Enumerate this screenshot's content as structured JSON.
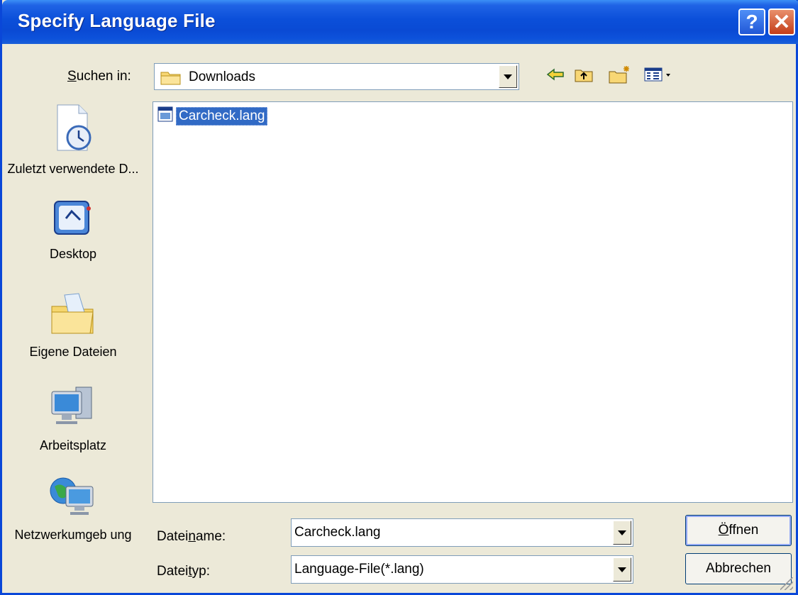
{
  "window": {
    "title": "Specify Language File"
  },
  "titlebar": {
    "help_label": "?",
    "close_label": "✕"
  },
  "toolbar": {
    "look_in_label_prefix": "",
    "look_in_label_key": "S",
    "look_in_label_rest": "uchen in:",
    "look_in_value": "Downloads",
    "icons": [
      "back-icon",
      "up-folder-icon",
      "new-folder-icon",
      "view-menu-icon"
    ]
  },
  "places": [
    {
      "label": "Zuletzt verwendete D...",
      "icon": "recent-documents-icon"
    },
    {
      "label": "Desktop",
      "icon": "desktop-icon"
    },
    {
      "label": "Eigene Dateien",
      "icon": "my-documents-icon"
    },
    {
      "label": "Arbeitsplatz",
      "icon": "my-computer-icon"
    },
    {
      "label": "Netzwerkumgeb ung",
      "icon": "network-icon"
    }
  ],
  "files": [
    {
      "name": "Carcheck.lang",
      "selected": true
    }
  ],
  "filename": {
    "label_pre": "Datei",
    "label_key": "n",
    "label_post": "ame:",
    "value": "Carcheck.lang"
  },
  "filetype": {
    "label_pre": "Datei",
    "label_key": "t",
    "label_post": "yp:",
    "value": "Language-File(*.lang)"
  },
  "buttons": {
    "open_key": "Ö",
    "open_rest": "ffnen",
    "cancel": "Abbrechen"
  },
  "colors": {
    "titlebar": "#0a4ad4",
    "selection": "#316ac5",
    "dialog_bg": "#ece9d8"
  }
}
